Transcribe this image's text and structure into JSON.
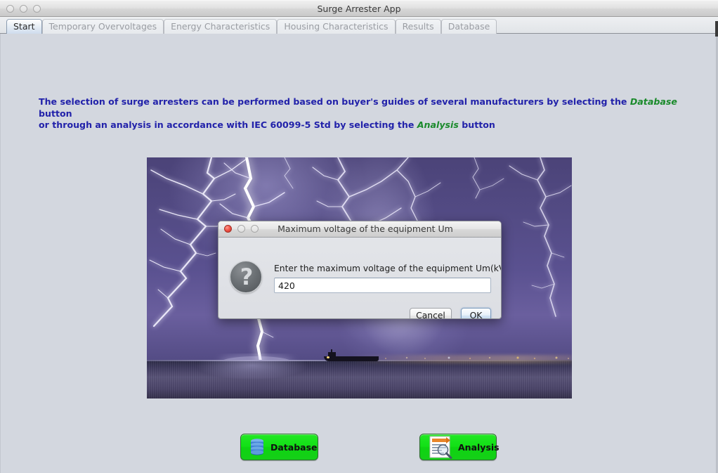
{
  "window": {
    "title": "Surge Arrester App",
    "traffic_lights": [
      "close-button",
      "minimize-button",
      "zoom-button"
    ]
  },
  "tabs": [
    {
      "label": "Start",
      "selected": true
    },
    {
      "label": "Temporary Overvoltages",
      "selected": false
    },
    {
      "label": "Energy Characteristics",
      "selected": false
    },
    {
      "label": "Housing Characteristics",
      "selected": false
    },
    {
      "label": "Results",
      "selected": false
    },
    {
      "label": "Database",
      "selected": false
    }
  ],
  "description": {
    "line1_part1": "The selection of surge arresters can be performed based on buyer's guides of several manufacturers by selecting the ",
    "line1_highlight": "Database",
    "line1_part2": " button",
    "line2_part1": "or through an analysis in accordance with IEC 60099-5 Std by selecting the ",
    "line2_highlight": "Analysis",
    "line2_part2": " button",
    "text_color": "#2222aa",
    "highlight_color": "#1a8a2b"
  },
  "photo": {
    "alt": "Night thunderstorm over the sea with lightning bolts, a ship silhouette and distant city lights"
  },
  "actions": {
    "database_label": "Database",
    "analysis_label": "Analysis",
    "button_color": "#12e016"
  },
  "dialog": {
    "title": "Maximum voltage of the equipment Um",
    "prompt": "Enter the maximum voltage of the equipment Um(kV)",
    "input_value": "420",
    "input_placeholder": "",
    "cancel_label": "Cancel",
    "ok_label": "OK",
    "icon": "question-mark-icon"
  }
}
